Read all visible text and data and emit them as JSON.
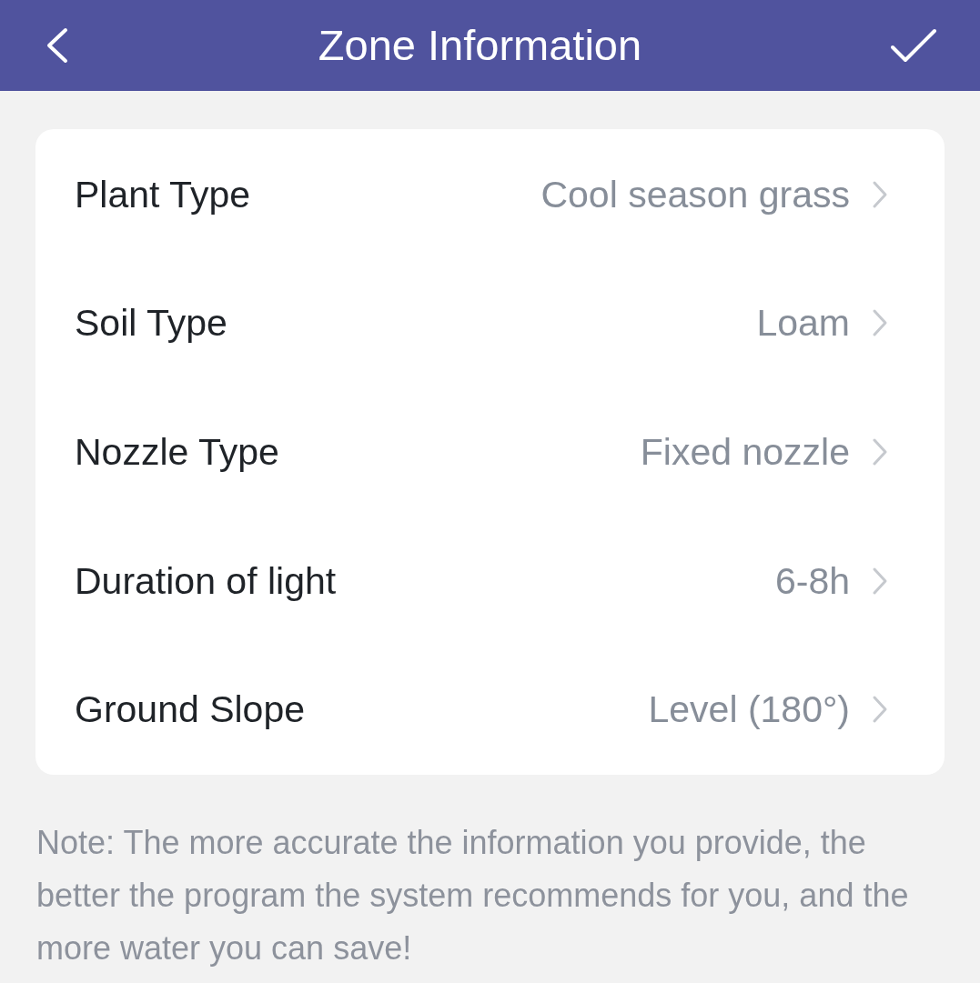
{
  "header": {
    "title": "Zone Information"
  },
  "settings": [
    {
      "label": "Plant Type",
      "value": "Cool season grass"
    },
    {
      "label": "Soil Type",
      "value": "Loam"
    },
    {
      "label": "Nozzle Type",
      "value": "Fixed nozzle"
    },
    {
      "label": "Duration of light",
      "value": "6-8h"
    },
    {
      "label": "Ground Slope",
      "value": "Level (180°)"
    }
  ],
  "note": "Note: The more accurate the information you provide, the better the program the system recommends for you, and the more water you can save!"
}
